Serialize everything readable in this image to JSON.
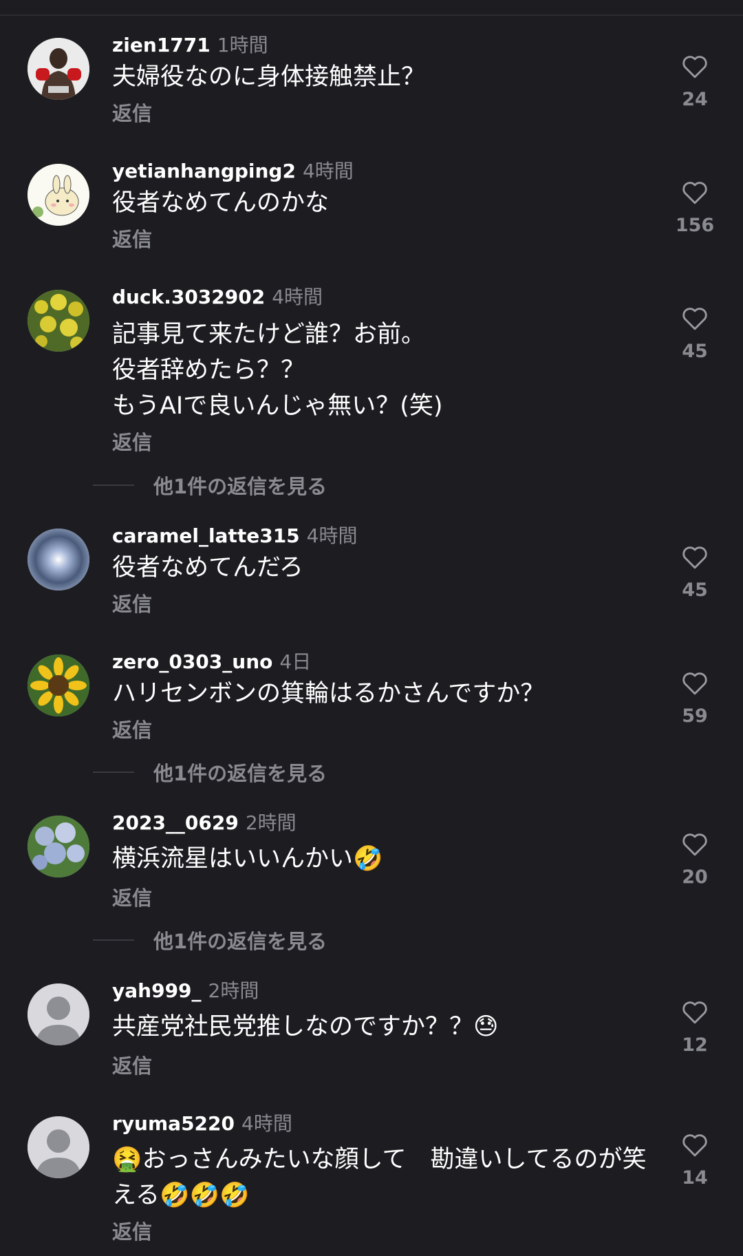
{
  "comments": [
    {
      "username": "zien1771",
      "time": "1時間",
      "text": "夫婦役なのに身体接触禁止？",
      "reply": "返信",
      "likes": "24"
    },
    {
      "username": "yetianhangping2",
      "time": "4時間",
      "text": "役者なめてんのかな",
      "reply": "返信",
      "likes": "156"
    },
    {
      "username": "duck.3032902",
      "time": "4時間",
      "text": "記事見て来たけど誰？お前。\n役者辞めたら？？\nもうAIで良いんじゃ無い？(笑)",
      "reply": "返信",
      "likes": "45"
    },
    {
      "username": "caramel_latte315",
      "time": "4時間",
      "text": "役者なめてんだろ",
      "reply": "返信",
      "likes": "45"
    },
    {
      "username": "zero_0303_uno",
      "time": "4日",
      "text": "ハリセンボンの箕輪はるかさんですか？",
      "reply": "返信",
      "likes": "59"
    },
    {
      "username": "2023__0629",
      "time": "2時間",
      "text": "横浜流星はいいんかい🤣",
      "reply": "返信",
      "likes": "20"
    },
    {
      "username": "yah999_",
      "time": "2時間",
      "text": "共産党社民党推しなのですか？？😓",
      "reply": "返信",
      "likes": "12"
    },
    {
      "username": "ryuma5220",
      "time": "4時間",
      "text": "🤮おっさんみたいな顔して　勘違いしてるのが笑える🤣🤣🤣",
      "reply": "返信",
      "likes": "14"
    }
  ],
  "view_more_replies": [
    "他1件の返信を見る",
    "他1件の返信を見る",
    "他1件の返信を見る"
  ],
  "icons": {
    "like": "heart-outline-icon",
    "default_avatar": "person-silhouette-icon"
  },
  "colors": {
    "background": "#1c1c21",
    "secondary_text": "#8a8b91"
  }
}
